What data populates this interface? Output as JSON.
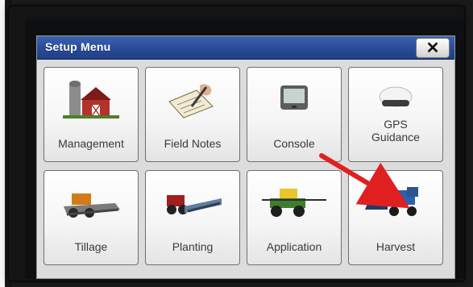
{
  "window": {
    "title": "Setup Menu",
    "close_label": "✕"
  },
  "tiles": [
    {
      "label": "Management",
      "icon": "farm-icon"
    },
    {
      "label": "Field Notes",
      "icon": "notes-icon"
    },
    {
      "label": "Console",
      "icon": "console-icon"
    },
    {
      "label": "GPS\nGuidance",
      "icon": "gps-receiver-icon"
    },
    {
      "label": "Tillage",
      "icon": "tillage-icon"
    },
    {
      "label": "Planting",
      "icon": "planter-icon"
    },
    {
      "label": "Application",
      "icon": "sprayer-icon"
    },
    {
      "label": "Harvest",
      "icon": "combine-icon"
    }
  ],
  "colors": {
    "titlebar": "#2a4d99",
    "annotation_arrow": "#e02020"
  }
}
